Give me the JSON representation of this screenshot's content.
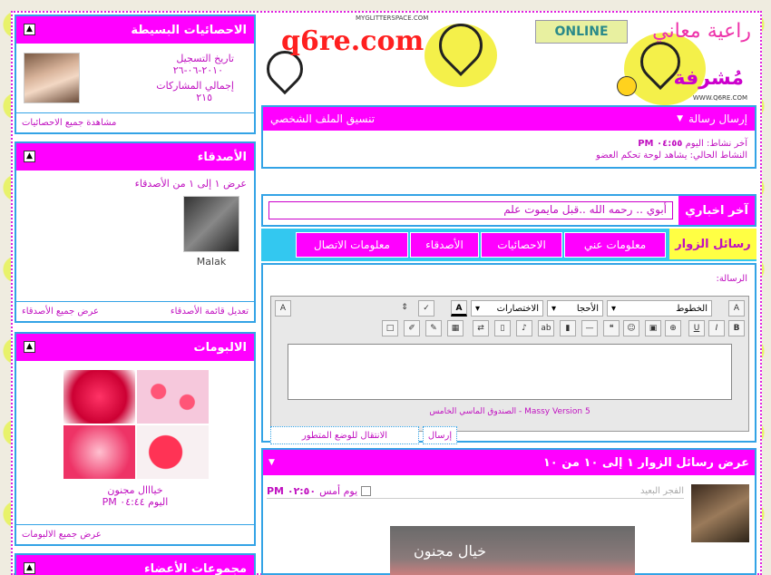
{
  "stats": {
    "title": "الاحصائيات البسيطة",
    "reg_label": "تاريخ التسجيل",
    "reg_date": "٢٠١٠-٠٦-٢٦",
    "posts_label": "إجمالي المشاركات",
    "posts_value": "٢١٥",
    "view_all": "مشاهدة جميع الاحصائيات"
  },
  "friends": {
    "title": "الأصدقاء",
    "showing": "عرض ١ إلى ١ من الأصدقاء",
    "friend_name": "Malak",
    "edit_list": "تعديل قائمة الأصدقاء",
    "view_all": "عرض جميع الأصدقاء"
  },
  "albums": {
    "title": "الالبومات",
    "album_name": "خيااال مجنون",
    "album_time": "اليوم ٠٤:٤٤ PM",
    "view_all": "عرض جميع الالبومات"
  },
  "groups": {
    "title": "مجموعات الأعضاء"
  },
  "banner": {
    "site": "q6re.com",
    "online": "ONLINE",
    "sub_title": "راعية معاني",
    "role": "مُشرفة",
    "myglitter": "MYGLITTERSPACE.COM",
    "q6re_small": "WWW.Q6RE.COM"
  },
  "profile": {
    "send_message": "إرسال رسالة",
    "customize": "تنسيق الملف الشخصي",
    "last_activity_label": "آخر نشاط: اليوم",
    "last_activity_time": "٠٤:٥٥ PM",
    "current_activity": "النشاط الحالي: يشاهد لوحة تحكم العضو"
  },
  "news": {
    "label": "آخر اخباري",
    "text": "أبوي .. رحمه الله ..قبل مايموت علم"
  },
  "tabs": [
    {
      "label": "رسائل الزوار"
    },
    {
      "label": "معلومات عني"
    },
    {
      "label": "الاحصائيات"
    },
    {
      "label": "الأصدقاء"
    },
    {
      "label": "معلومات الاتصال"
    }
  ],
  "visitor": {
    "message_label": "الرسالة:",
    "font_label": "الخطوط",
    "size_label": "الأحجا",
    "shortcuts_label": "الاختصارات",
    "editor_footer": "الصندوق الماسي الخامس - Massy Version 5",
    "send": "إرسال",
    "advanced": "الانتقال للوضع المتطور",
    "list_title": "عرض رسائل الزوار ١ إلى ١٠ من ١٠",
    "entry_author": "الفجر البعيد",
    "entry_time_label": "يوم أمس",
    "entry_time": "٠٢:٥٠ PM",
    "entry_image_text": "خيال مجنون"
  }
}
